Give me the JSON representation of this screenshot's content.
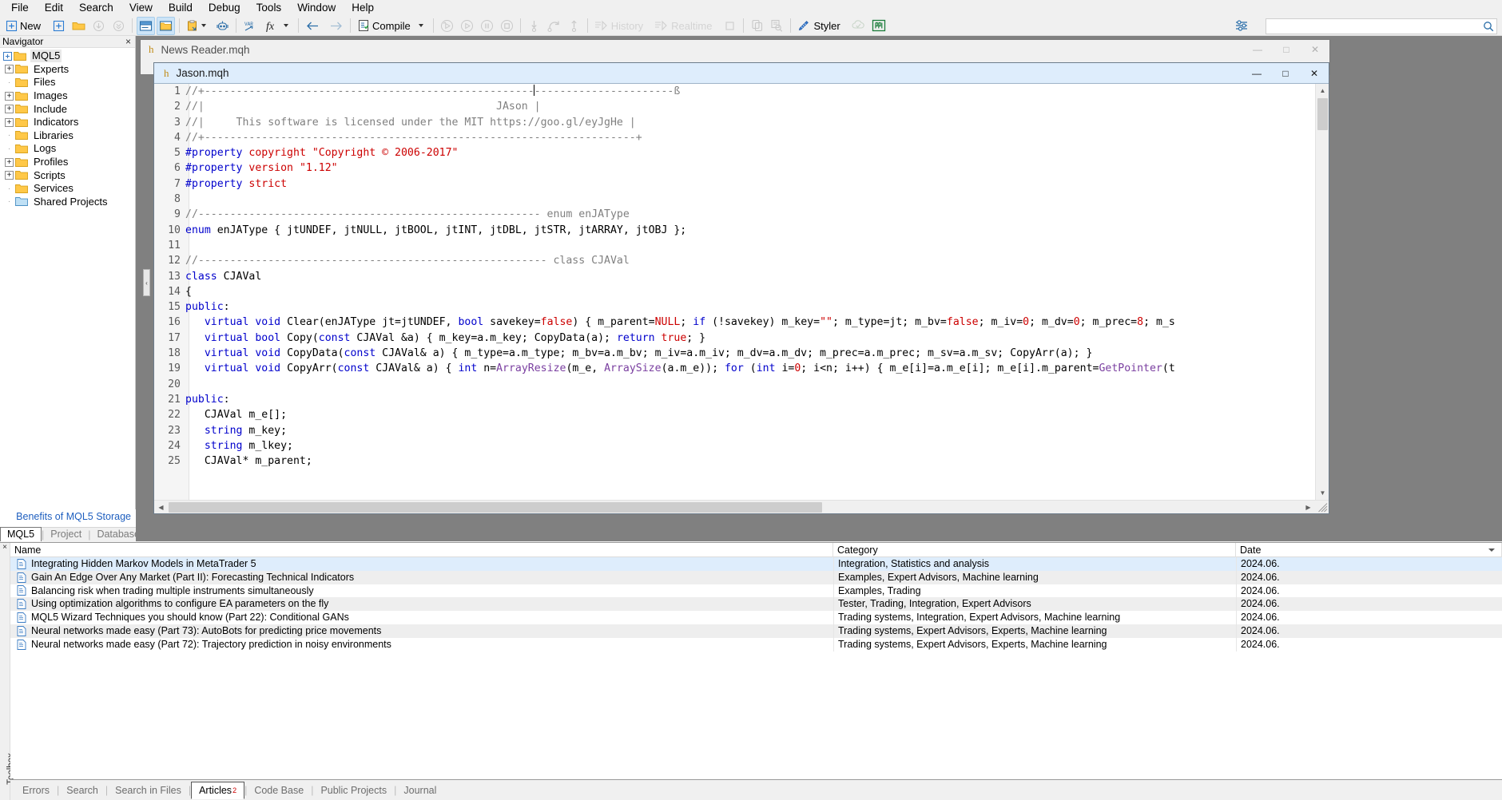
{
  "menu": {
    "items": [
      "File",
      "Edit",
      "Search",
      "View",
      "Build",
      "Debug",
      "Tools",
      "Window",
      "Help"
    ]
  },
  "toolbar": {
    "new_label": "New",
    "compile_label": "Compile",
    "history_label": "History",
    "realtime_label": "Realtime",
    "styler_label": "Styler",
    "icons": [
      "new-file-icon",
      "add-icon",
      "open-folder-icon",
      "download-icon",
      "download-all-icon",
      "toggle-navigator-icon",
      "toggle-toolbox-icon",
      "clipboard-icon",
      "dropdown-caret-icon",
      "robot-icon",
      "variables-icon",
      "function-icon",
      "back-arrow-icon",
      "forward-arrow-icon",
      "compile-icon",
      "debug-start-icon",
      "debug-run-icon",
      "debug-pause-icon",
      "debug-stop-icon",
      "step-into-icon",
      "step-over-icon",
      "step-out-icon",
      "history-icon",
      "realtime-icon",
      "stop-square-icon",
      "copy-icon",
      "find-in-files-icon",
      "styler-icon",
      "cloud-check-icon",
      "metaquotes-icon",
      "settings-icon",
      "search-icon"
    ]
  },
  "search": {
    "value": "",
    "placeholder": ""
  },
  "navigator": {
    "title": "Navigator",
    "close_label": "×",
    "tree": [
      {
        "label": "MQL5",
        "kind": "root",
        "expander": "-",
        "selected": true
      },
      {
        "label": "Experts",
        "kind": "folder",
        "expander": "+"
      },
      {
        "label": "Files",
        "kind": "folder",
        "expander": ""
      },
      {
        "label": "Images",
        "kind": "folder",
        "expander": "+"
      },
      {
        "label": "Include",
        "kind": "folder",
        "expander": "+"
      },
      {
        "label": "Indicators",
        "kind": "folder",
        "expander": "+"
      },
      {
        "label": "Libraries",
        "kind": "folder",
        "expander": ""
      },
      {
        "label": "Logs",
        "kind": "folder",
        "expander": ""
      },
      {
        "label": "Profiles",
        "kind": "folder",
        "expander": "+"
      },
      {
        "label": "Scripts",
        "kind": "folder",
        "expander": "+"
      },
      {
        "label": "Services",
        "kind": "folder",
        "expander": ""
      },
      {
        "label": "Shared Projects",
        "kind": "folder-blue",
        "expander": ""
      }
    ],
    "storage_link": "Benefits of MQL5 Storage",
    "tabs": [
      "MQL5",
      "Project",
      "Database"
    ],
    "selected_tab": "MQL5"
  },
  "editor": {
    "outer_window": {
      "file_icon": "h",
      "title": "News Reader.mqh",
      "minimize": "—",
      "maximize": "□",
      "close": "✕"
    },
    "inner_window": {
      "file_icon": "h",
      "title": "Jason.mqh",
      "minimize": "—",
      "maximize": "□",
      "close": "✕"
    },
    "lines": [
      {
        "n": 1,
        "tokens": [
          {
            "t": "//+----------------------------------------------------",
            "c": "cmt"
          },
          {
            "t": "CURSOR"
          },
          {
            "t": "----------------------ß",
            "c": "cmt"
          }
        ]
      },
      {
        "n": 2,
        "tokens": [
          {
            "t": "//|                                              JAson |",
            "c": "cmt"
          }
        ]
      },
      {
        "n": 3,
        "tokens": [
          {
            "t": "//|     This software is licensed under the MIT https://goo.gl/eyJgHe |",
            "c": "cmt"
          }
        ]
      },
      {
        "n": 4,
        "tokens": [
          {
            "t": "//+--------------------------------------------------------------------+",
            "c": "cmt"
          }
        ]
      },
      {
        "n": 5,
        "tokens": [
          {
            "t": "#property",
            "c": "pre"
          },
          {
            "t": " ",
            "c": "plain"
          },
          {
            "t": "copyright",
            "c": "prop"
          },
          {
            "t": " ",
            "c": "plain"
          },
          {
            "t": "\"Copyright © 2006-2017\"",
            "c": "str"
          }
        ]
      },
      {
        "n": 6,
        "tokens": [
          {
            "t": "#property",
            "c": "pre"
          },
          {
            "t": " ",
            "c": "plain"
          },
          {
            "t": "version",
            "c": "prop"
          },
          {
            "t": " ",
            "c": "plain"
          },
          {
            "t": "\"1.12\"",
            "c": "str"
          }
        ]
      },
      {
        "n": 7,
        "tokens": [
          {
            "t": "#property",
            "c": "pre"
          },
          {
            "t": " ",
            "c": "plain"
          },
          {
            "t": "strict",
            "c": "prop"
          }
        ]
      },
      {
        "n": 8,
        "tokens": []
      },
      {
        "n": 9,
        "tokens": [
          {
            "t": "//------------------------------------------------------ enum enJAType",
            "c": "cmt"
          }
        ]
      },
      {
        "n": 10,
        "tokens": [
          {
            "t": "enum",
            "c": "kw"
          },
          {
            "t": " enJAType { jtUNDEF, jtNULL, jtBOOL, jtINT, jtDBL, jtSTR, jtARRAY, jtOBJ };",
            "c": "plain"
          }
        ]
      },
      {
        "n": 11,
        "tokens": []
      },
      {
        "n": 12,
        "tokens": [
          {
            "t": "//------------------------------------------------------- class CJAVal",
            "c": "cmt"
          }
        ]
      },
      {
        "n": 13,
        "tokens": [
          {
            "t": "class",
            "c": "kw"
          },
          {
            "t": " CJAVal",
            "c": "plain"
          }
        ]
      },
      {
        "n": 14,
        "tokens": [
          {
            "t": "{",
            "c": "plain"
          }
        ]
      },
      {
        "n": 15,
        "tokens": [
          {
            "t": "public",
            "c": "kw"
          },
          {
            "t": ":",
            "c": "plain"
          }
        ]
      },
      {
        "n": 16,
        "tokens": [
          {
            "t": "   ",
            "c": "plain"
          },
          {
            "t": "virtual",
            "c": "kw"
          },
          {
            "t": " ",
            "c": "plain"
          },
          {
            "t": "void",
            "c": "kw"
          },
          {
            "t": " Clear(enJAType jt=jtUNDEF, ",
            "c": "plain"
          },
          {
            "t": "bool",
            "c": "kw"
          },
          {
            "t": " savekey=",
            "c": "plain"
          },
          {
            "t": "false",
            "c": "num"
          },
          {
            "t": ") { m_parent=",
            "c": "plain"
          },
          {
            "t": "NULL",
            "c": "num"
          },
          {
            "t": "; ",
            "c": "plain"
          },
          {
            "t": "if",
            "c": "kw"
          },
          {
            "t": " (!savekey) m_key=",
            "c": "plain"
          },
          {
            "t": "\"\"",
            "c": "str"
          },
          {
            "t": "; m_type=jt; m_bv=",
            "c": "plain"
          },
          {
            "t": "false",
            "c": "num"
          },
          {
            "t": "; m_iv=",
            "c": "plain"
          },
          {
            "t": "0",
            "c": "num"
          },
          {
            "t": "; m_dv=",
            "c": "plain"
          },
          {
            "t": "0",
            "c": "num"
          },
          {
            "t": "; m_prec=",
            "c": "plain"
          },
          {
            "t": "8",
            "c": "num"
          },
          {
            "t": "; m_s",
            "c": "plain"
          }
        ]
      },
      {
        "n": 17,
        "tokens": [
          {
            "t": "   ",
            "c": "plain"
          },
          {
            "t": "virtual",
            "c": "kw"
          },
          {
            "t": " ",
            "c": "plain"
          },
          {
            "t": "bool",
            "c": "kw"
          },
          {
            "t": " Copy(",
            "c": "plain"
          },
          {
            "t": "const",
            "c": "kw"
          },
          {
            "t": " CJAVal &a) { m_key=a.m_key; CopyData(a); ",
            "c": "plain"
          },
          {
            "t": "return",
            "c": "kw"
          },
          {
            "t": " ",
            "c": "plain"
          },
          {
            "t": "true",
            "c": "num"
          },
          {
            "t": "; }",
            "c": "plain"
          }
        ]
      },
      {
        "n": 18,
        "tokens": [
          {
            "t": "   ",
            "c": "plain"
          },
          {
            "t": "virtual",
            "c": "kw"
          },
          {
            "t": " ",
            "c": "plain"
          },
          {
            "t": "void",
            "c": "kw"
          },
          {
            "t": " CopyData(",
            "c": "plain"
          },
          {
            "t": "const",
            "c": "kw"
          },
          {
            "t": " CJAVal& a) { m_type=a.m_type; m_bv=a.m_bv; m_iv=a.m_iv; m_dv=a.m_dv; m_prec=a.m_prec; m_sv=a.m_sv; CopyArr(a); }",
            "c": "plain"
          }
        ]
      },
      {
        "n": 19,
        "tokens": [
          {
            "t": "   ",
            "c": "plain"
          },
          {
            "t": "virtual",
            "c": "kw"
          },
          {
            "t": " ",
            "c": "plain"
          },
          {
            "t": "void",
            "c": "kw"
          },
          {
            "t": " CopyArr(",
            "c": "plain"
          },
          {
            "t": "const",
            "c": "kw"
          },
          {
            "t": " CJAVal& a) { ",
            "c": "plain"
          },
          {
            "t": "int",
            "c": "kw"
          },
          {
            "t": " n=",
            "c": "plain"
          },
          {
            "t": "ArrayResize",
            "c": "fn"
          },
          {
            "t": "(m_e, ",
            "c": "plain"
          },
          {
            "t": "ArraySize",
            "c": "fn"
          },
          {
            "t": "(a.m_e)); ",
            "c": "plain"
          },
          {
            "t": "for",
            "c": "kw"
          },
          {
            "t": " (",
            "c": "plain"
          },
          {
            "t": "int",
            "c": "kw"
          },
          {
            "t": " i=",
            "c": "plain"
          },
          {
            "t": "0",
            "c": "num"
          },
          {
            "t": "; i<n; i++) { m_e[i]=a.m_e[i]; m_e[i].m_parent=",
            "c": "plain"
          },
          {
            "t": "GetPointer",
            "c": "fn"
          },
          {
            "t": "(t",
            "c": "plain"
          }
        ]
      },
      {
        "n": 20,
        "tokens": []
      },
      {
        "n": 21,
        "tokens": [
          {
            "t": "public",
            "c": "kw"
          },
          {
            "t": ":",
            "c": "plain"
          }
        ]
      },
      {
        "n": 22,
        "tokens": [
          {
            "t": "   CJAVal m_e[];",
            "c": "plain"
          }
        ]
      },
      {
        "n": 23,
        "tokens": [
          {
            "t": "   ",
            "c": "plain"
          },
          {
            "t": "string",
            "c": "kw"
          },
          {
            "t": " m_key;",
            "c": "plain"
          }
        ]
      },
      {
        "n": 24,
        "tokens": [
          {
            "t": "   ",
            "c": "plain"
          },
          {
            "t": "string",
            "c": "kw"
          },
          {
            "t": " m_lkey;",
            "c": "plain"
          }
        ]
      },
      {
        "n": 25,
        "tokens": [
          {
            "t": "   CJAVal* m_parent;",
            "c": "plain"
          }
        ]
      }
    ]
  },
  "toolbox": {
    "rail_label": "Toolbox",
    "rail_close": "×",
    "columns": [
      "Name",
      "Category",
      "Date"
    ],
    "rows": [
      {
        "name": "Integrating Hidden Markov Models in MetaTrader 5",
        "category": "Integration, Statistics and analysis",
        "date": "2024.06.",
        "selected": true
      },
      {
        "name": "Gain An Edge Over Any Market (Part II): Forecasting Technical Indicators",
        "category": "Examples, Expert Advisors, Machine learning",
        "date": "2024.06."
      },
      {
        "name": "Balancing risk when trading multiple instruments simultaneously",
        "category": "Examples, Trading",
        "date": "2024.06."
      },
      {
        "name": "Using optimization algorithms to configure EA parameters on the fly",
        "category": "Tester, Trading, Integration, Expert Advisors",
        "date": "2024.06."
      },
      {
        "name": "MQL5 Wizard Techniques you should know (Part 22): Conditional GANs",
        "category": "Trading systems, Integration, Expert Advisors, Machine learning",
        "date": "2024.06."
      },
      {
        "name": "Neural networks made easy (Part 73): AutoBots for predicting price movements",
        "category": "Trading systems, Expert Advisors, Experts, Machine learning",
        "date": "2024.06."
      },
      {
        "name": "Neural networks made easy (Part 72): Trajectory prediction in noisy environments",
        "category": "Trading systems, Expert Advisors, Experts, Machine learning",
        "date": "2024.06."
      }
    ],
    "tabs": [
      {
        "label": "Errors"
      },
      {
        "label": "Search"
      },
      {
        "label": "Search in Files"
      },
      {
        "label": "Articles",
        "badge": "2",
        "selected": true
      },
      {
        "label": "Code Base"
      },
      {
        "label": "Public Projects"
      },
      {
        "label": "Journal"
      }
    ]
  },
  "colors": {
    "accent_blue": "#deedfc",
    "folder_yellow": "#ffc848",
    "link_blue": "#1f5fbf",
    "badge_red": "#cc0000",
    "editor_backdrop": "#808080"
  }
}
